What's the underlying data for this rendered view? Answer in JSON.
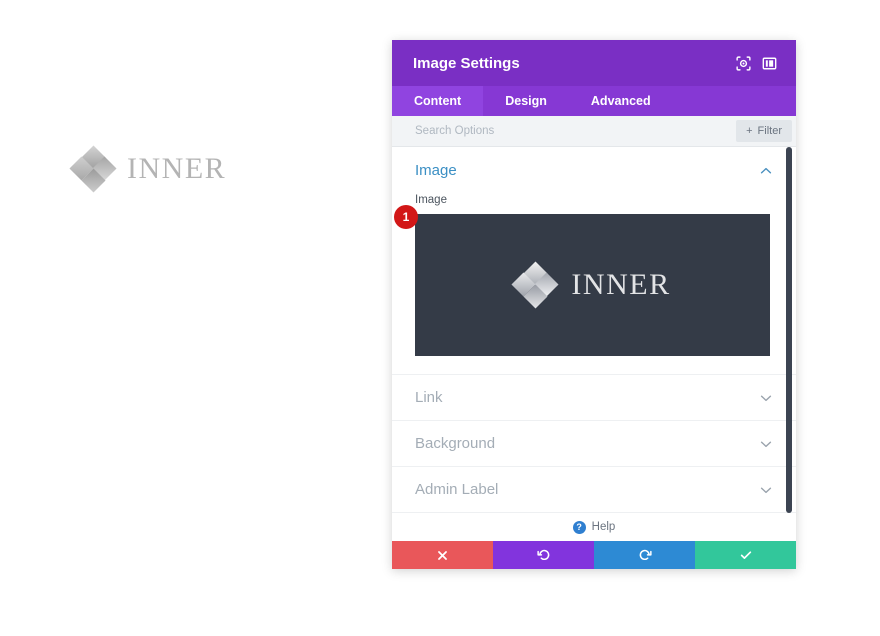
{
  "canvas": {
    "logo": {
      "icon": "inner-diamond-logo",
      "word": "INNER"
    }
  },
  "modal": {
    "title": "Image Settings",
    "header_icons": [
      {
        "name": "focus-target-icon",
        "glyph": "target"
      },
      {
        "name": "layout-panel-icon",
        "glyph": "panel"
      }
    ],
    "tabs": [
      {
        "label": "Content",
        "active": true
      },
      {
        "label": "Design",
        "active": false
      },
      {
        "label": "Advanced",
        "active": false
      }
    ],
    "search": {
      "placeholder": "Search Options",
      "value": ""
    },
    "filter_button": {
      "label": "Filter",
      "plus": "+"
    },
    "sections": [
      {
        "title": "Image",
        "state": "open",
        "chevron": "chevron-up",
        "field_label": "Image",
        "badge": "1",
        "preview": {
          "word": "INNER",
          "icon": "inner-diamond-logo"
        }
      },
      {
        "title": "Link",
        "state": "closed",
        "chevron": "chevron-down"
      },
      {
        "title": "Background",
        "state": "closed",
        "chevron": "chevron-down"
      },
      {
        "title": "Admin Label",
        "state": "closed",
        "chevron": "chevron-down"
      }
    ],
    "help": {
      "icon_glyph": "?",
      "label": "Help"
    },
    "footer_buttons": [
      {
        "name": "cancel-button",
        "glyph": "✖",
        "color": "#e9575a"
      },
      {
        "name": "undo-button",
        "glyph": "↺",
        "color": "#8234dd"
      },
      {
        "name": "redo-button",
        "glyph": "↻",
        "color": "#2d8ad4"
      },
      {
        "name": "save-button",
        "glyph": "✔",
        "color": "#32c79b"
      }
    ]
  }
}
